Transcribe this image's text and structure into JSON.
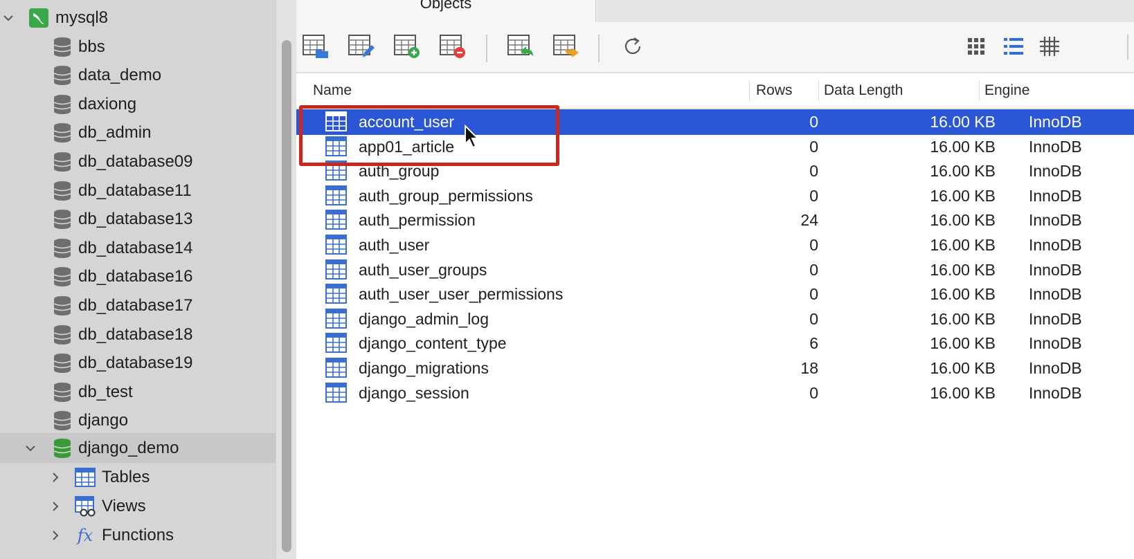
{
  "sidebar": {
    "connection": {
      "label": "mysql8"
    },
    "databases": [
      "bbs",
      "data_demo",
      "daxiong",
      "db_admin",
      "db_database09",
      "db_database11",
      "db_database13",
      "db_database14",
      "db_database16",
      "db_database17",
      "db_database18",
      "db_database19",
      "db_test",
      "django"
    ],
    "active_database": {
      "label": "django_demo"
    },
    "children": [
      {
        "label": "Tables",
        "icon": "table-icon"
      },
      {
        "label": "Views",
        "icon": "view-icon"
      },
      {
        "label": "Functions",
        "icon": "function-icon"
      }
    ]
  },
  "tabs": {
    "objects_label": "Objects"
  },
  "toolbar": {
    "buttons": [
      "open-table-icon",
      "design-table-icon",
      "new-table-icon",
      "delete-table-icon",
      "import-wizard-icon",
      "export-wizard-icon",
      "refresh-icon"
    ],
    "view_modes": [
      "grid-view-icon",
      "list-view-icon",
      "detail-view-icon"
    ]
  },
  "table": {
    "columns": {
      "name": "Name",
      "rows": "Rows",
      "data_length": "Data Length",
      "engine": "Engine"
    },
    "rows": [
      {
        "name": "account_user",
        "rows": "0",
        "data_length": "16.00 KB",
        "engine": "InnoDB",
        "selected": true
      },
      {
        "name": "app01_article",
        "rows": "0",
        "data_length": "16.00 KB",
        "engine": "InnoDB"
      },
      {
        "name": "auth_group",
        "rows": "0",
        "data_length": "16.00 KB",
        "engine": "InnoDB"
      },
      {
        "name": "auth_group_permissions",
        "rows": "0",
        "data_length": "16.00 KB",
        "engine": "InnoDB"
      },
      {
        "name": "auth_permission",
        "rows": "24",
        "data_length": "16.00 KB",
        "engine": "InnoDB"
      },
      {
        "name": "auth_user",
        "rows": "0",
        "data_length": "16.00 KB",
        "engine": "InnoDB"
      },
      {
        "name": "auth_user_groups",
        "rows": "0",
        "data_length": "16.00 KB",
        "engine": "InnoDB"
      },
      {
        "name": "auth_user_user_permissions",
        "rows": "0",
        "data_length": "16.00 KB",
        "engine": "InnoDB"
      },
      {
        "name": "django_admin_log",
        "rows": "0",
        "data_length": "16.00 KB",
        "engine": "InnoDB"
      },
      {
        "name": "django_content_type",
        "rows": "6",
        "data_length": "16.00 KB",
        "engine": "InnoDB"
      },
      {
        "name": "django_migrations",
        "rows": "18",
        "data_length": "16.00 KB",
        "engine": "InnoDB"
      },
      {
        "name": "django_session",
        "rows": "0",
        "data_length": "16.00 KB",
        "engine": "InnoDB"
      }
    ]
  },
  "colors": {
    "selection": "#2b57d6",
    "highlight_box": "#c8281e",
    "db_icon": "#6e6e6e",
    "active_db_icon": "#3a9a3a",
    "table_icon": "#3a6fd0"
  }
}
